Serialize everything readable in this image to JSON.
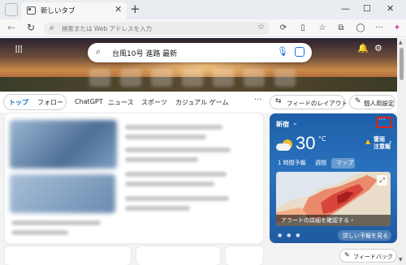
{
  "browser": {
    "tab_title": "新しいタブ",
    "tab_close": "✕",
    "new_tab": "+",
    "window_controls": [
      "—",
      "☐",
      "✕"
    ],
    "address_placeholder": "検索または Web アドレスを入力",
    "icons": [
      "back-icon",
      "refresh-icon",
      "search-icon",
      "favorite-star-icon",
      "extensions-icon",
      "split-screen-icon",
      "favorites-icon",
      "collections-icon",
      "browser-essentials-icon",
      "profile-icon",
      "settings-more-icon",
      "copilot-icon"
    ]
  },
  "hero": {
    "search_query": "台風10号 進路 最新",
    "apps_icon": "grid-icon",
    "notification_icon": "bell-icon",
    "settings_icon": "gear-icon"
  },
  "nav": {
    "items": [
      "トップ",
      "フォロー",
      "ChatGPT",
      "ニュース",
      "スポーツ",
      "カジュアル ゲーム"
    ],
    "active_index": 0,
    "more": "···",
    "layout_button": "フィードのレイアウト",
    "personal_button": "個人用設定"
  },
  "weather": {
    "location": "新宿",
    "more": "···",
    "temperature": "30",
    "unit": "°C",
    "alert_line1": "雷雨",
    "alert_line2": "注意報",
    "tabs": [
      "1 時間予報",
      "週間",
      "マップ"
    ],
    "active_tab": "マップ",
    "map_label": "アラートの詳細を確認する ›",
    "forecast_button": "詳しい予報を見る",
    "dots": "● ● ●"
  },
  "feedback": {
    "label": "フィードバック"
  },
  "colors": {
    "accent": "#0f6cbd",
    "weather_bg": "#2a72be",
    "highlight_box": "#e0201b"
  }
}
